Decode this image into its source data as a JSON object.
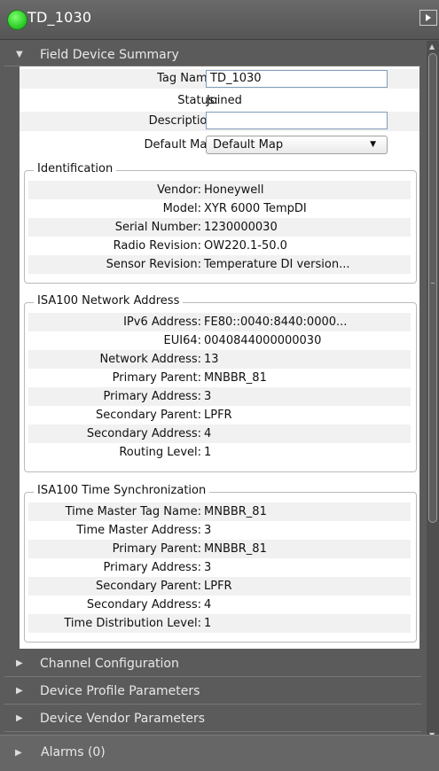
{
  "window": {
    "title": "TD_1030",
    "status_color": "#2fcf2b"
  },
  "field_device_summary": {
    "header": "Field Device Summary",
    "tag_name_label": "Tag Name:",
    "tag_name_value": "TD_1030",
    "status_label": "Status:",
    "status_value": "Joined",
    "description_label": "Description:",
    "description_value": "",
    "default_map_label": "Default Map:",
    "default_map_value": "Default Map"
  },
  "identification": {
    "legend": "Identification",
    "rows": [
      {
        "label": "Vendor:",
        "value": "Honeywell"
      },
      {
        "label": "Model:",
        "value": "XYR 6000 TempDI"
      },
      {
        "label": "Serial Number:",
        "value": "1230000030"
      },
      {
        "label": "Radio Revision:",
        "value": "OW220.1-50.0"
      },
      {
        "label": "Sensor Revision:",
        "value": "Temperature DI version..."
      }
    ]
  },
  "network_address": {
    "legend": "ISA100 Network Address",
    "rows": [
      {
        "label": "IPv6 Address:",
        "value": "FE80::0040:8440:0000..."
      },
      {
        "label": "EUI64:",
        "value": "0040844000000030"
      },
      {
        "label": "Network Address:",
        "value": "13"
      },
      {
        "label": "Primary Parent:",
        "value": "MNBBR_81"
      },
      {
        "label": "Primary Address:",
        "value": "3"
      },
      {
        "label": "Secondary Parent:",
        "value": "LPFR"
      },
      {
        "label": "Secondary Address:",
        "value": "4"
      },
      {
        "label": "Routing Level:",
        "value": "1"
      }
    ]
  },
  "time_sync": {
    "legend": "ISA100 Time Synchronization",
    "rows": [
      {
        "label": "Time Master Tag Name:",
        "value": "MNBBR_81"
      },
      {
        "label": "Time Master Address:",
        "value": "3"
      },
      {
        "label": "Primary Parent:",
        "value": "MNBBR_81"
      },
      {
        "label": "Primary Address:",
        "value": "3"
      },
      {
        "label": "Secondary Parent:",
        "value": "LPFR"
      },
      {
        "label": "Secondary Address:",
        "value": "4"
      },
      {
        "label": "Time Distribution Level:",
        "value": "1"
      }
    ]
  },
  "collapsed_sections": [
    {
      "label": "Channel Configuration"
    },
    {
      "label": "Device Profile Parameters"
    },
    {
      "label": "Device Vendor Parameters"
    }
  ],
  "alarms": {
    "label": "Alarms (0)"
  }
}
